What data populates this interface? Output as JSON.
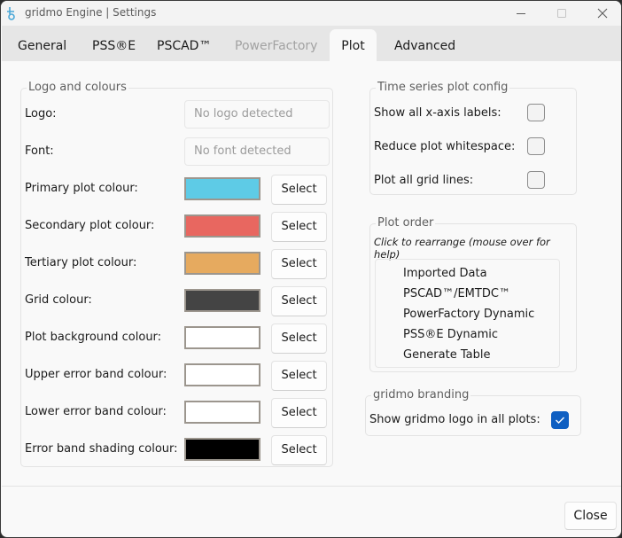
{
  "window": {
    "title": "gridmo Engine | Settings",
    "icon": "gridmo-app-icon",
    "controls": [
      "minimize",
      "maximize",
      "close"
    ]
  },
  "tabs": [
    {
      "label": "General",
      "state": "normal"
    },
    {
      "label": "PSS®E",
      "state": "normal"
    },
    {
      "label": "PSCAD™",
      "state": "normal"
    },
    {
      "label": "PowerFactory",
      "state": "disabled"
    },
    {
      "label": "Plot",
      "state": "active"
    },
    {
      "label": "Advanced",
      "state": "normal"
    }
  ],
  "logo_colours": {
    "title": "Logo and colours",
    "logo": {
      "label": "Logo:",
      "value": "No logo detected"
    },
    "font": {
      "label": "Font:",
      "value": "No font detected"
    },
    "select_label": "Select",
    "colours": [
      {
        "label": "Primary plot colour:",
        "color": "#5ecbe6"
      },
      {
        "label": "Secondary plot colour:",
        "color": "#e86760"
      },
      {
        "label": "Tertiary plot colour:",
        "color": "#e6aa5f"
      },
      {
        "label": "Grid colour:",
        "color": "#444444"
      },
      {
        "label": "Plot background colour:",
        "color": "#ffffff"
      },
      {
        "label": "Upper error band colour:",
        "color": "#ffffff"
      },
      {
        "label": "Lower error band colour:",
        "color": "#ffffff"
      },
      {
        "label": "Error band shading colour:",
        "color": "#000000"
      }
    ]
  },
  "time_series": {
    "title": "Time series plot config",
    "options": [
      {
        "label": "Show all x-axis labels:",
        "checked": false
      },
      {
        "label": "Reduce plot whitespace:",
        "checked": false
      },
      {
        "label": "Plot all grid lines:",
        "checked": false
      }
    ]
  },
  "plot_order": {
    "title": "Plot order",
    "hint": "Click to rearrange (mouse over for help)",
    "items": [
      "Imported Data",
      "PSCAD™/EMTDC™",
      "PowerFactory Dynamic",
      "PSS®E Dynamic",
      "Generate Table"
    ]
  },
  "branding": {
    "title": "gridmo branding",
    "option": {
      "label": "Show gridmo logo in all plots:",
      "checked": true
    }
  },
  "footer": {
    "close_label": "Close"
  },
  "colors": {
    "accent": "#0f5fc2",
    "brand_icon": "#4aa8d8"
  }
}
